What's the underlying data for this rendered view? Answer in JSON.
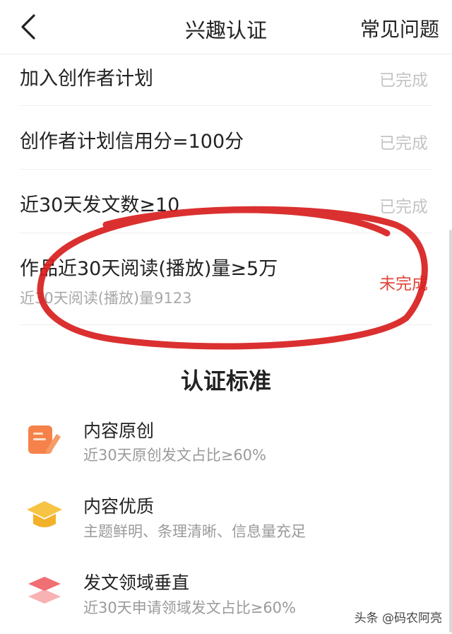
{
  "header": {
    "title": "兴趣认证",
    "faq_label": "常见问题"
  },
  "requirements": [
    {
      "title": "加入创作者计划",
      "status": "已完成"
    },
    {
      "title": "创作者计划信用分=100分",
      "status": "已完成"
    },
    {
      "title": "近30天发文数≥10",
      "status": "已完成"
    },
    {
      "title": "作品近30天阅读(播放)量≥5万",
      "subtitle": "近30天阅读(播放)量9123",
      "status": "未完成"
    }
  ],
  "standards": {
    "title": "认证标准",
    "items": [
      {
        "icon": "edit-document-icon",
        "title": "内容原创",
        "desc": "近30天原创发文占比≥60%"
      },
      {
        "icon": "graduation-cap-icon",
        "title": "内容优质",
        "desc": "主题鲜明、条理清晰、信息量充足"
      },
      {
        "icon": "layers-icon",
        "title": "发文领域垂直",
        "desc": "近30天申请领域发文占比≥60%"
      }
    ]
  },
  "watermark": "头条 @码农阿亮",
  "colors": {
    "done": "#c4c4c4",
    "pending": "#e0463a",
    "annotation": "#d81e1e",
    "orange": "#f4824a",
    "yellow": "#f6c343",
    "pink": "#ef6f73"
  }
}
